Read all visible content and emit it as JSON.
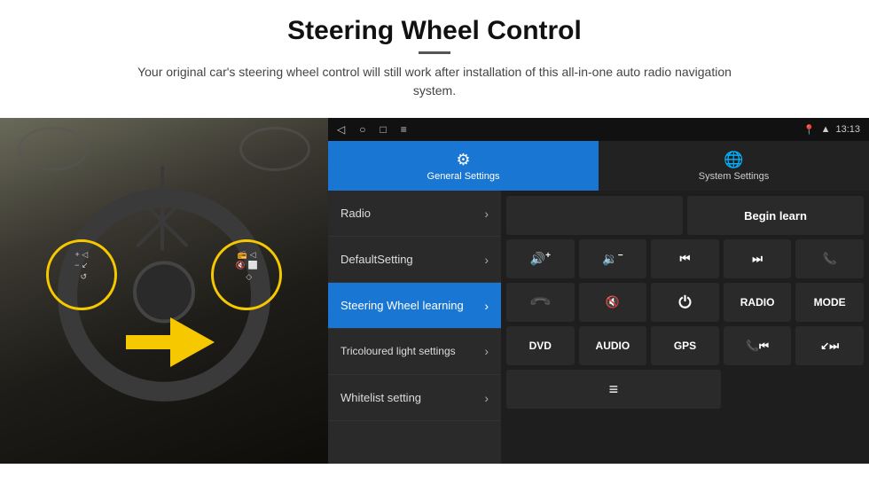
{
  "header": {
    "title": "Steering Wheel Control",
    "subtitle": "Your original car's steering wheel control will still work after installation of this all-in-one auto radio navigation system."
  },
  "status_bar": {
    "time": "13:13",
    "icons": [
      "back",
      "home",
      "square",
      "menu",
      "location",
      "wifi",
      "signal"
    ]
  },
  "tabs": [
    {
      "id": "general",
      "label": "General Settings",
      "active": true
    },
    {
      "id": "system",
      "label": "System Settings",
      "active": false
    }
  ],
  "menu": [
    {
      "id": "radio",
      "label": "Radio",
      "active": false
    },
    {
      "id": "default",
      "label": "DefaultSetting",
      "active": false
    },
    {
      "id": "steering",
      "label": "Steering Wheel learning",
      "active": true
    },
    {
      "id": "tricoloured",
      "label": "Tricoloured light settings",
      "active": false
    },
    {
      "id": "whitelist",
      "label": "Whitelist setting",
      "active": false
    }
  ],
  "controls": {
    "begin_learn_label": "Begin learn",
    "row1": [
      {
        "id": "vol-up",
        "icon": "🔊+",
        "type": "icon"
      },
      {
        "id": "vol-down",
        "icon": "🔉−",
        "type": "icon"
      },
      {
        "id": "prev-track",
        "icon": "⏮",
        "type": "icon"
      },
      {
        "id": "next-track",
        "icon": "⏭",
        "type": "icon"
      },
      {
        "id": "phone",
        "icon": "📞",
        "type": "icon"
      }
    ],
    "row2": [
      {
        "id": "hang-up",
        "icon": "📵",
        "type": "icon"
      },
      {
        "id": "mute",
        "icon": "🔇",
        "type": "icon"
      },
      {
        "id": "power",
        "icon": "⏻",
        "type": "icon"
      },
      {
        "id": "radio-btn",
        "label": "RADIO",
        "type": "label"
      },
      {
        "id": "mode-btn",
        "label": "MODE",
        "type": "label"
      }
    ],
    "row3": [
      {
        "id": "dvd",
        "label": "DVD",
        "type": "label"
      },
      {
        "id": "audio",
        "label": "AUDIO",
        "type": "label"
      },
      {
        "id": "gps",
        "label": "GPS",
        "type": "label"
      },
      {
        "id": "phone2",
        "icon": "📞⏮",
        "type": "icon"
      },
      {
        "id": "prev2",
        "icon": "⏭↙",
        "type": "icon"
      }
    ],
    "row4": [
      {
        "id": "list",
        "icon": "≡",
        "type": "icon"
      }
    ]
  }
}
